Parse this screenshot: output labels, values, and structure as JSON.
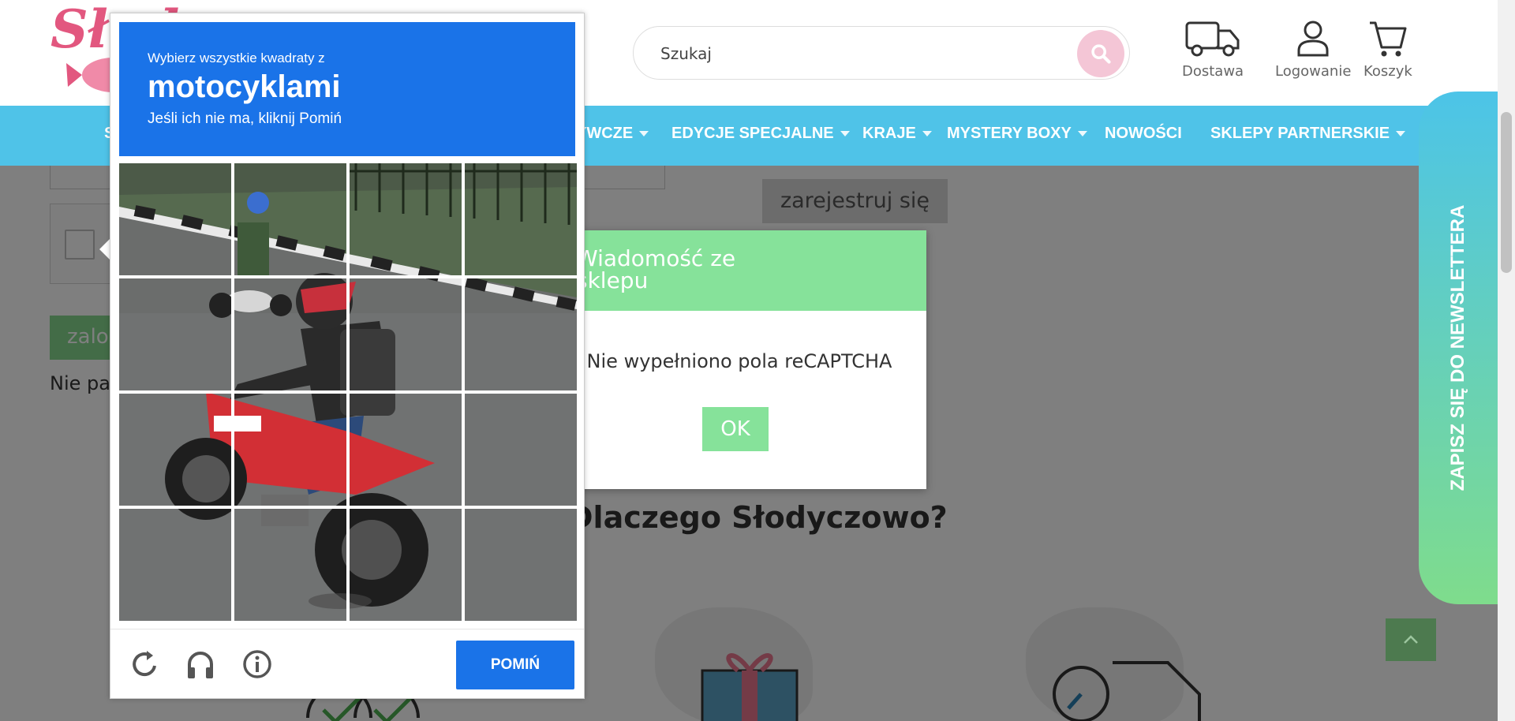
{
  "header": {
    "search_placeholder": "Szukaj",
    "icons": [
      {
        "name": "delivery-icon",
        "label": "Dostawa"
      },
      {
        "name": "user-icon",
        "label": "Logowanie"
      },
      {
        "name": "cart-icon",
        "label": "Koszyk"
      }
    ]
  },
  "nav": {
    "items": [
      {
        "label": "S",
        "caret": false
      },
      {
        "label": "YWCZE",
        "caret": true
      },
      {
        "label": "EDYCJE SPECJALNE",
        "caret": true
      },
      {
        "label": "KRAJE",
        "caret": true
      },
      {
        "label": "MYSTERY BOXY",
        "caret": true
      },
      {
        "label": "NOWOŚCI",
        "caret": false
      },
      {
        "label": "SKLEPY PARTNERSKIE",
        "caret": true
      }
    ]
  },
  "page": {
    "register_label": "zarejestruj się",
    "login_label": "zalo",
    "forgot_text": "Nie pa",
    "heading": "Dlaczego Słodyczowo?"
  },
  "newsletter": {
    "label": "ZAPISZ SIĘ DO NEWSLETTERA"
  },
  "shop_message": {
    "title_line1": "Wiadomość ze",
    "title_line2": "sklepu",
    "body": "Nie wypełniono pola reCAPTCHA",
    "ok_label": "OK"
  },
  "recaptcha": {
    "instruction": "Wybierz wszystkie kwadraty z",
    "object": "motocyklami",
    "hint": "Jeśli ich nie ma, kliknij Pomiń",
    "skip_label": "POMIŃ",
    "footer_icons": [
      "reload-icon",
      "audio-icon",
      "info-icon"
    ]
  },
  "colors": {
    "nav_bg": "#4fc3e8",
    "recaptcha_blue": "#1a73e8",
    "shop_green": "#86e29a"
  }
}
